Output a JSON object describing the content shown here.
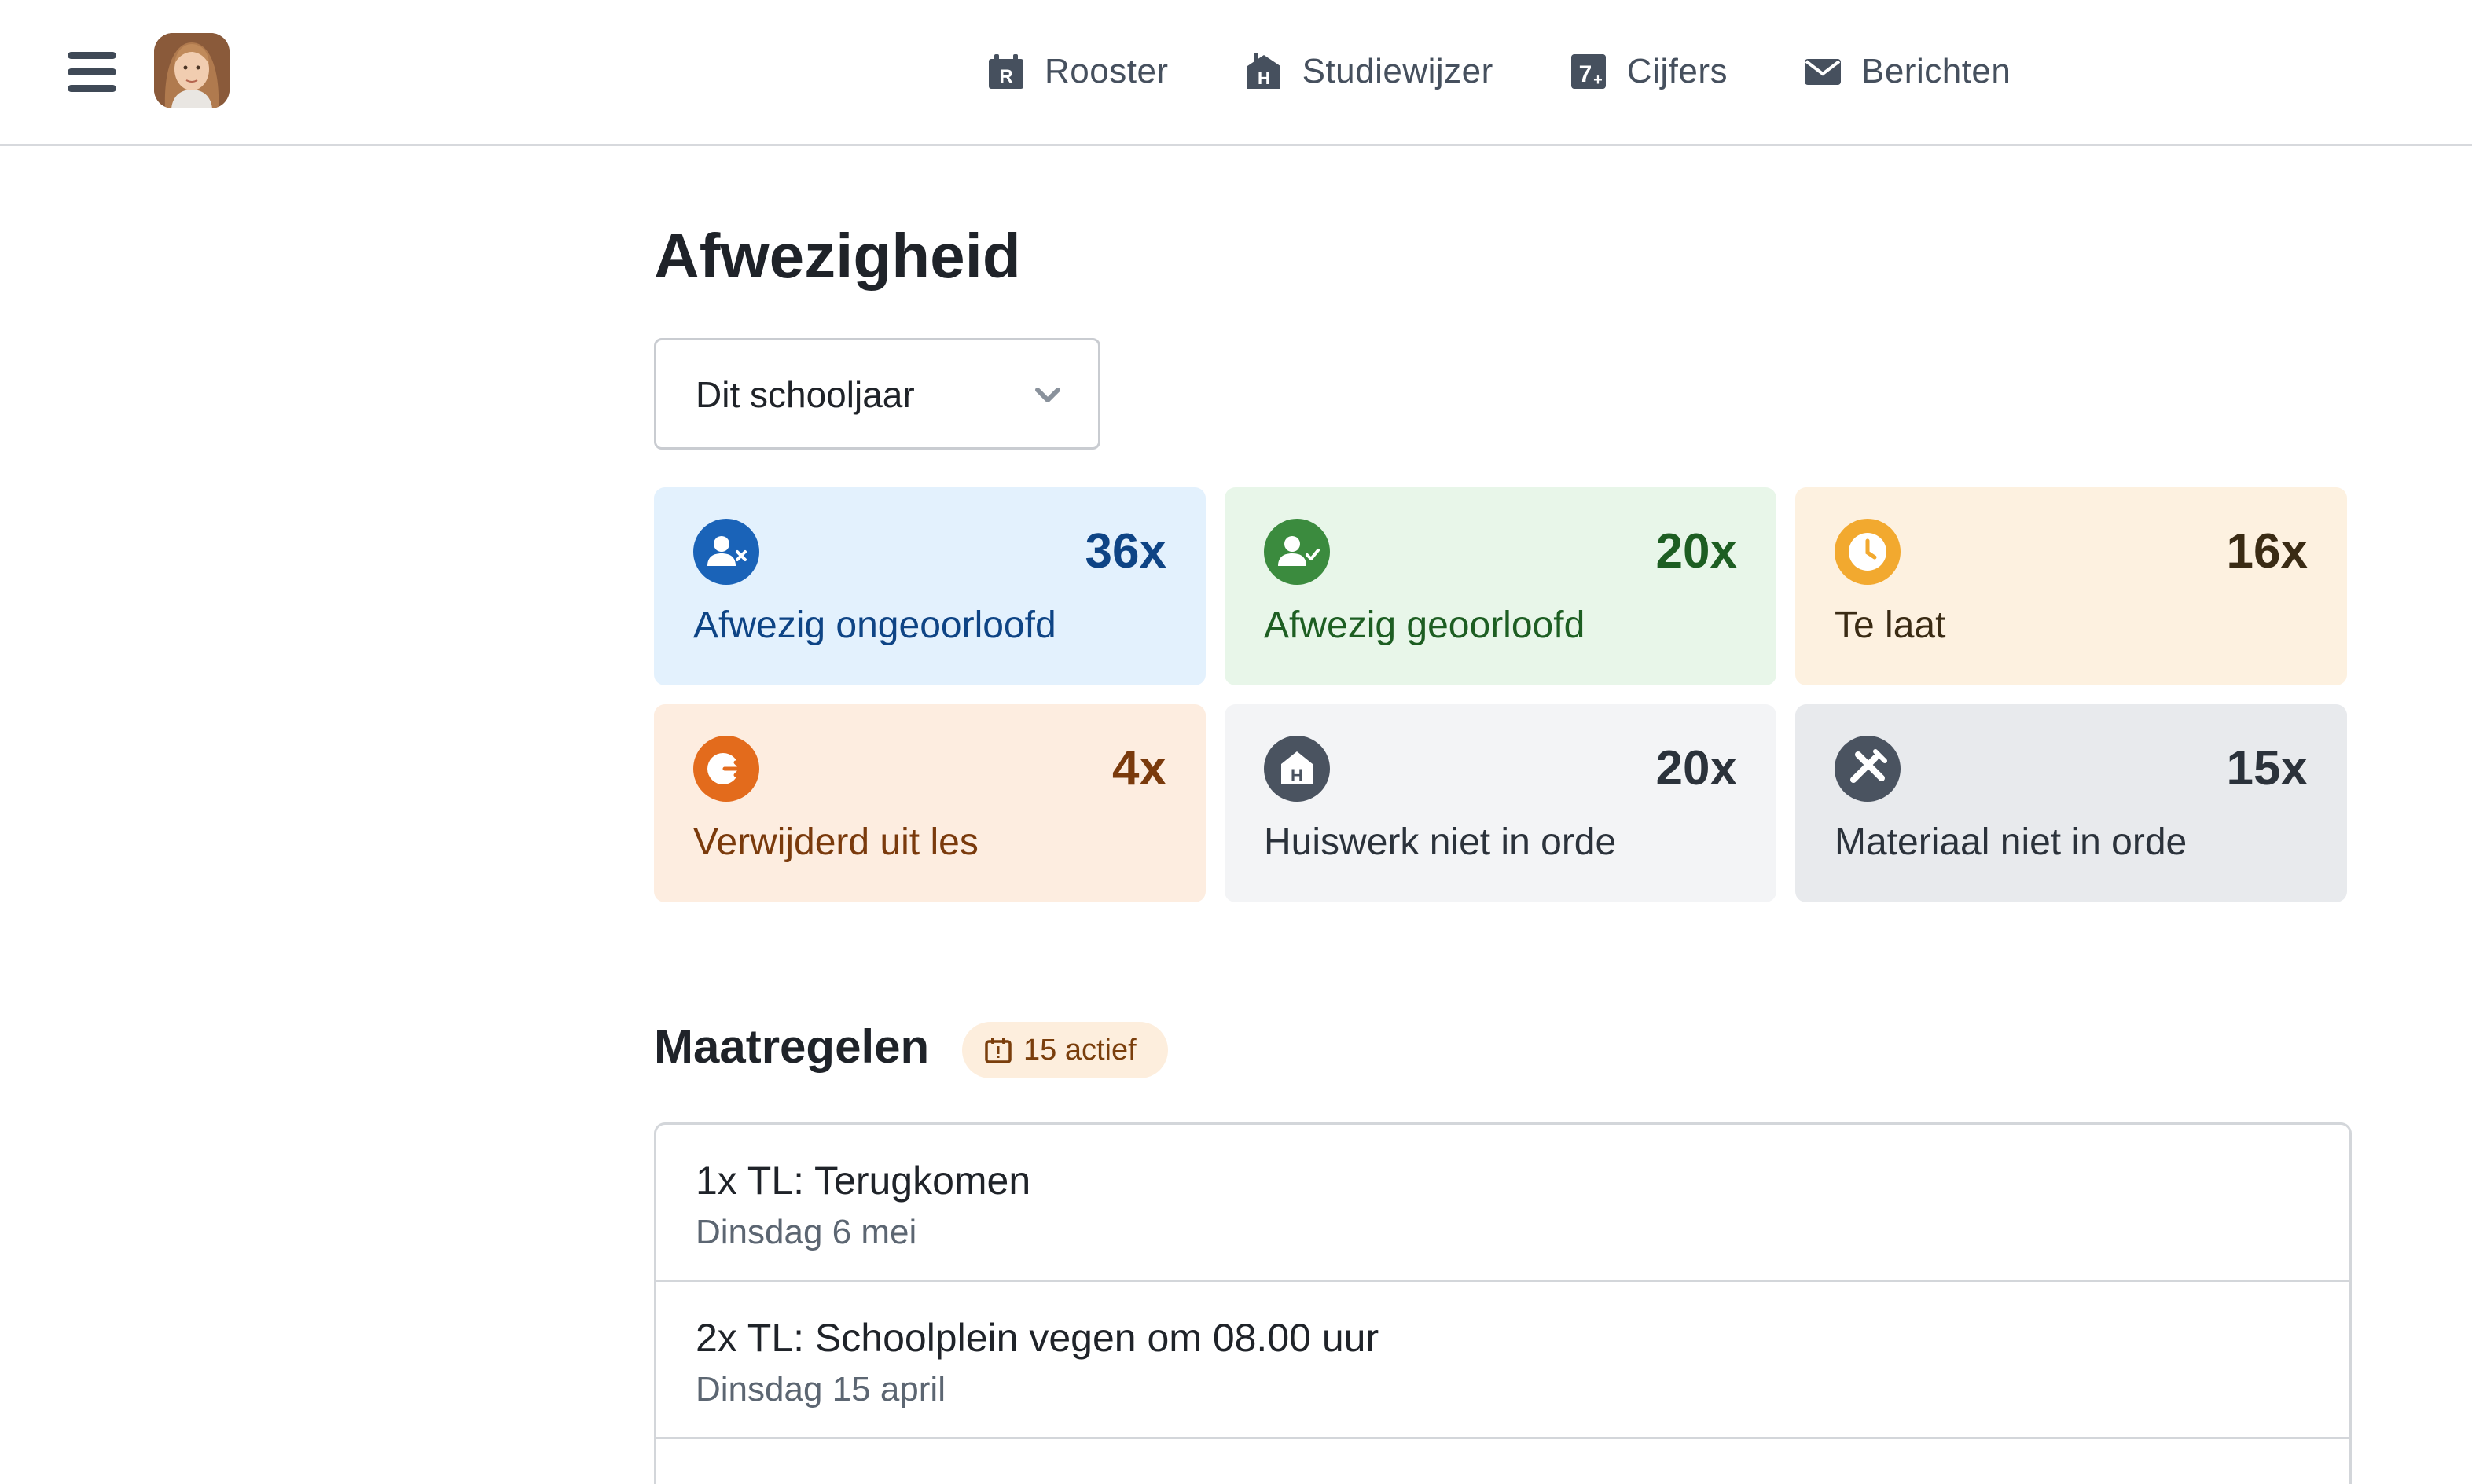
{
  "nav": {
    "items": [
      {
        "label": "Rooster",
        "icon": "rooster-icon"
      },
      {
        "label": "Studiewijzer",
        "icon": "studiewijzer-icon"
      },
      {
        "label": "Cijfers",
        "icon": "cijfers-icon"
      },
      {
        "label": "Berichten",
        "icon": "envelope-icon"
      }
    ]
  },
  "page": {
    "title": "Afwezigheid"
  },
  "filter": {
    "selected": "Dit schooljaar"
  },
  "cards": [
    {
      "count": "36x",
      "label": "Afwezig ongeoorloofd",
      "icon": "user-x-icon",
      "bg": "#e3f1fd",
      "accent": "#1a63b8",
      "text": "#0e4485"
    },
    {
      "count": "20x",
      "label": "Afwezig geoorloofd",
      "icon": "user-check-icon",
      "bg": "#e8f6e9",
      "accent": "#3b8b3e",
      "text": "#1d5e22"
    },
    {
      "count": "16x",
      "label": "Te laat",
      "icon": "clock-icon",
      "bg": "#fdf1e0",
      "accent": "#f2a92f",
      "text": "#3a2b14"
    },
    {
      "count": "4x",
      "label": "Verwijderd uit les",
      "icon": "exit-icon",
      "bg": "#fdede0",
      "accent": "#e36b1c",
      "text": "#7a3a0c"
    },
    {
      "count": "20x",
      "label": "Huiswerk niet in orde",
      "icon": "homework-icon",
      "bg": "#f3f4f6",
      "accent": "#4a5360",
      "text": "#2b323b"
    },
    {
      "count": "15x",
      "label": "Materiaal niet in orde",
      "icon": "tools-icon",
      "bg": "#e8eaed",
      "accent": "#4a5360",
      "text": "#2b323b"
    }
  ],
  "maatregelen": {
    "title": "Maatregelen",
    "badge": "15 actief",
    "items": [
      {
        "title": "1x TL: Terugkomen",
        "date": "Dinsdag 6 mei"
      },
      {
        "title": "2x TL: Schoolplein vegen om 08.00 uur",
        "date": "Dinsdag 15 april"
      }
    ]
  }
}
